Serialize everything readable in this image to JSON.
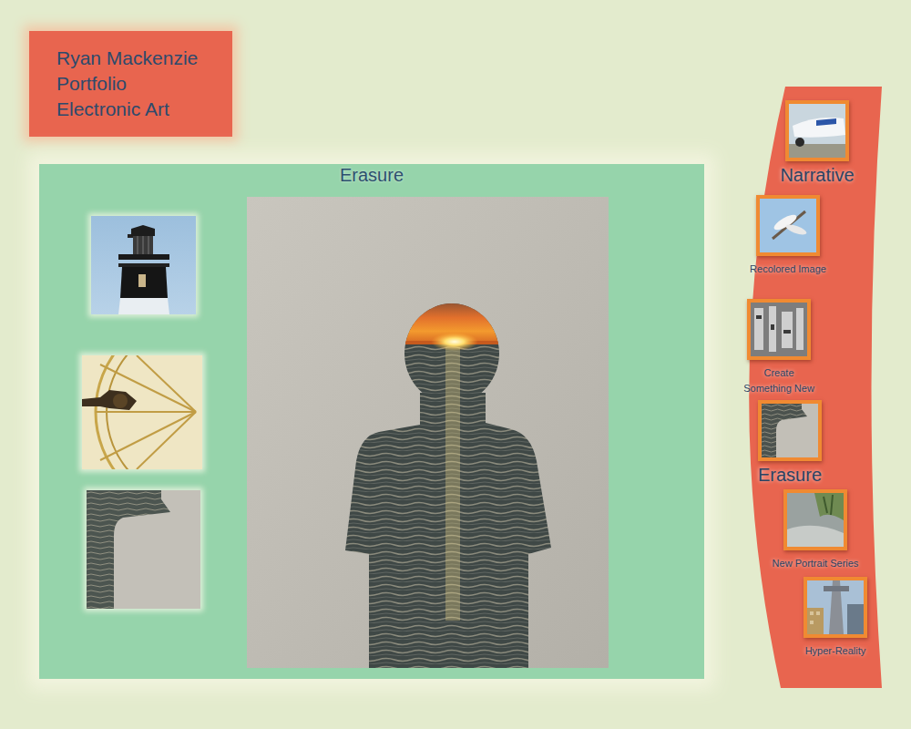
{
  "header": {
    "lines": [
      "Ryan Mackenzie",
      "Portfolio",
      "Electronic Art"
    ]
  },
  "gallery": {
    "title": "Erasure"
  },
  "sidebar": {
    "items": [
      {
        "label": "Narrative",
        "kind": "large"
      },
      {
        "label": "Recolored Image",
        "kind": "small"
      },
      {
        "label": "Create Something New",
        "kind": "small"
      },
      {
        "label": "Erasure",
        "kind": "large"
      },
      {
        "label": "New Portrait Series",
        "kind": "small"
      },
      {
        "label": "Hyper-Reality",
        "kind": "small"
      }
    ]
  }
}
